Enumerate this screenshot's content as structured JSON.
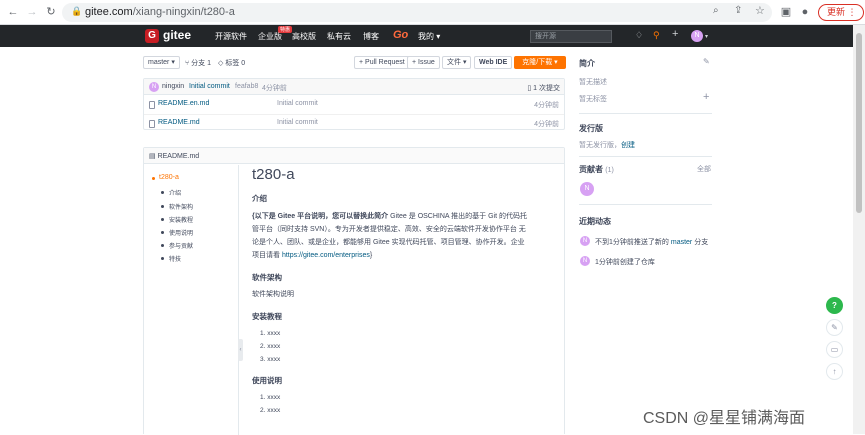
{
  "browser": {
    "url_host": "gitee.com",
    "url_path": "/xiang-ningxin/t280-a",
    "update_label": "更新"
  },
  "nav": {
    "logo_text": "gitee",
    "items": [
      "开源软件",
      "企业版",
      "高校版",
      "私有云",
      "博客"
    ],
    "hot_badge": "特惠",
    "go": "Go",
    "mine": "我的",
    "search_placeholder": "搜开源"
  },
  "toolbar": {
    "branch": "master",
    "branches": "分支 1",
    "tags": "标签 0",
    "pull_request": "+ Pull Request",
    "issue": "+ Issue",
    "file": "文件",
    "webide": "Web IDE",
    "clone": "克隆/下载"
  },
  "commit": {
    "avatar_letter": "N",
    "author": "ningxin",
    "message": "Initial commit",
    "hash": "feafab8",
    "time": "4分钟前",
    "count": "1 次提交"
  },
  "files": [
    {
      "name": "README.en.md",
      "message": "Initial commit",
      "time": "4分钟前"
    },
    {
      "name": "README.md",
      "message": "Initial commit",
      "time": "4分钟前"
    }
  ],
  "readme": {
    "header": "README.md",
    "toc": [
      "t280-a",
      "介绍",
      "软件架构",
      "安装教程",
      "使用说明",
      "参与贡献",
      "特技"
    ],
    "title": "t280-a",
    "intro_heading": "介绍",
    "intro_bold": "{以下是 Gitee 平台说明，您可以替换此简介",
    "intro_text_1": "Gitee 是 OSCHINA 推出的基于 Git 的代码托",
    "intro_text_2": "管平台（同时支持 SVN）。专为开发者提供稳定、高效、安全的云端软件开发协作平台 无",
    "intro_text_3": "论是个人、团队、或是企业，都能够用 Gitee 实现代码托管、项目管理、协作开发。企业",
    "intro_text_4": "项目请看",
    "intro_link": "https://gitee.com/enterprises",
    "intro_end": "}",
    "arch_heading": "软件架构",
    "arch_text": "软件架构说明",
    "install_heading": "安装教程",
    "install_items": [
      "xxxx",
      "xxxx",
      "xxxx"
    ],
    "usage_heading": "使用说明",
    "usage_items": [
      "xxxx",
      "xxxx"
    ]
  },
  "sidebar": {
    "intro_title": "简介",
    "no_desc": "暂无描述",
    "no_tags": "暂无标签",
    "release_title": "发行版",
    "no_release": "暂无发行版，",
    "create": "创建",
    "contrib_title": "贡献者",
    "contrib_count": "(1)",
    "all": "全部",
    "contrib_letter": "N",
    "activity_title": "近期动态",
    "activity": [
      {
        "letter": "N",
        "text": "不到1分钟前推送了新的",
        "link": "master",
        "suffix": "分支"
      },
      {
        "letter": "N",
        "text": "1分钟前创建了仓库",
        "link": "",
        "suffix": ""
      }
    ]
  },
  "watermark": "CSDN @星星铺满海面",
  "colors": {
    "nav_bg": "#232629",
    "brand_red": "#c71d23",
    "clone_orange": "#fe7300",
    "link_blue": "#005980",
    "toc_active": "#fe7300",
    "help_green": "#2db84d"
  }
}
